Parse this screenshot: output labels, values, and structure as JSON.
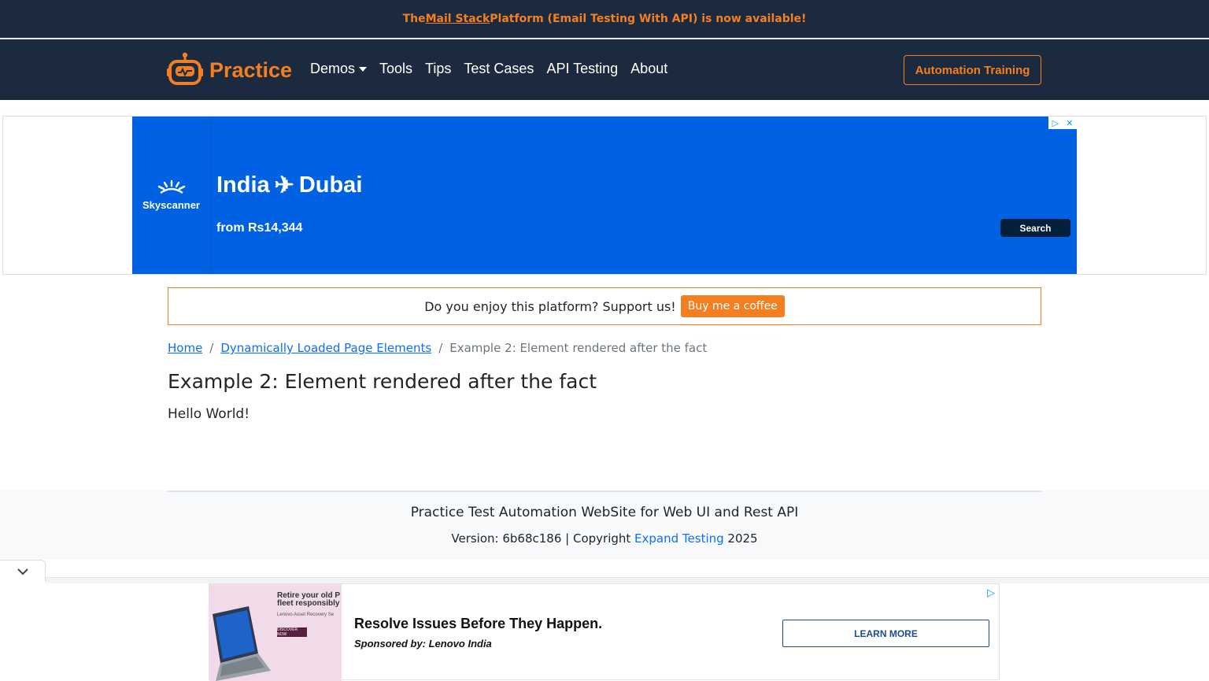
{
  "announcement": {
    "prefix": "The ",
    "link": "Mail Stack",
    "suffix": " Platform (Email Testing With API) is now available!"
  },
  "navbar": {
    "brand": "Practice",
    "items": [
      {
        "label": "Demos",
        "dropdown": true
      },
      {
        "label": "Tools"
      },
      {
        "label": "Tips"
      },
      {
        "label": "Test Cases"
      },
      {
        "label": "API Testing"
      },
      {
        "label": "About"
      }
    ],
    "cta": "Automation Training"
  },
  "top_ad": {
    "logo": "Skyscanner",
    "origin": "India",
    "destination": "Dubai",
    "price": "from Rs14,344",
    "button": "Search"
  },
  "support": {
    "text": "Do you enjoy this platform? Support us!",
    "button": "Buy me a coffee"
  },
  "breadcrumb": {
    "home": "Home",
    "parent": "Dynamically Loaded Page Elements",
    "current": "Example 2: Element rendered after the fact"
  },
  "main": {
    "title": "Example 2: Element rendered after the fact",
    "message": "Hello World!"
  },
  "footer": {
    "title": "Practice Test Automation WebSite for Web UI and Rest API",
    "version_prefix": "Version: 6b68c186 | Copyright ",
    "company": "Expand Testing",
    "year": " 2025"
  },
  "bottom_ad": {
    "thumb_title": "Retire your old P fleet responsibly",
    "thumb_sub": "Lenovo Asset Recovery Se",
    "thumb_button": "DISCOVER NOW",
    "headline": "Resolve Issues Before They Happen.",
    "sponsor": "Sponsored by: Lenovo India",
    "button": "LEARN MORE"
  },
  "colors": {
    "navy": "#1c2a3f",
    "accent": "#f47f21",
    "link": "#0d6efd",
    "ad_blue": "#0062e3"
  }
}
